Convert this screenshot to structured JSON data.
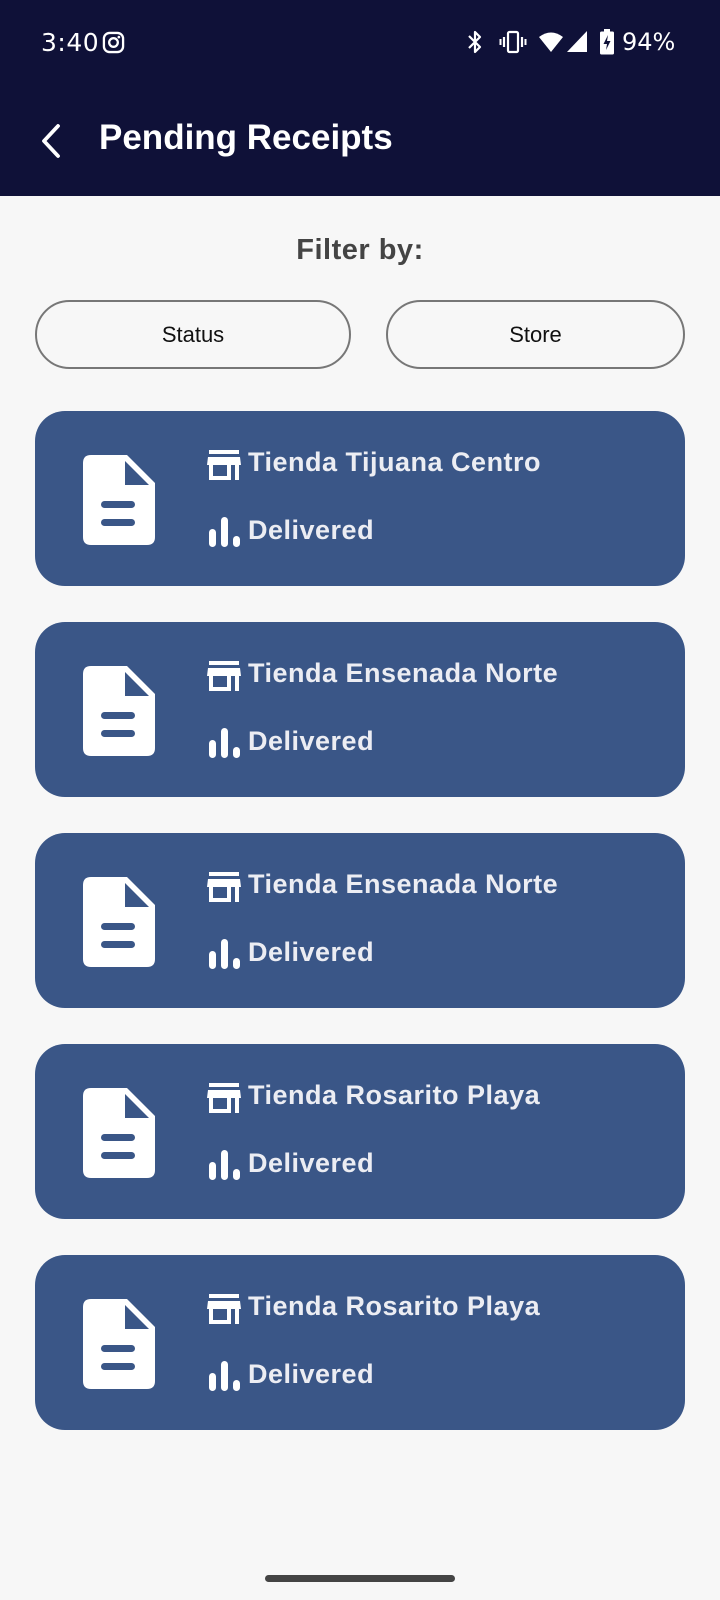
{
  "status_bar": {
    "time": "3:40",
    "battery": "94%",
    "icons": [
      "instagram-icon",
      "bluetooth-icon",
      "vibrate-icon",
      "wifi-icon",
      "cellular-icon",
      "battery-charging-icon"
    ]
  },
  "header": {
    "title": "Pending Receipts",
    "back_icon": "chevron-left-icon",
    "background_color": "#0f1138"
  },
  "filters": {
    "label": "Filter by:",
    "status_label": "Status",
    "store_label": "Store"
  },
  "receipts": [
    {
      "store": "Tienda Tijuana Centro",
      "status": "Delivered"
    },
    {
      "store": "Tienda Ensenada Norte",
      "status": "Delivered"
    },
    {
      "store": "Tienda Ensenada Norte",
      "status": "Delivered"
    },
    {
      "store": "Tienda Rosarito Playa",
      "status": "Delivered"
    },
    {
      "store": "Tienda Rosarito Playa",
      "status": "Delivered"
    }
  ],
  "colors": {
    "card": "#3a5687",
    "page_background": "#f7f7f7"
  }
}
